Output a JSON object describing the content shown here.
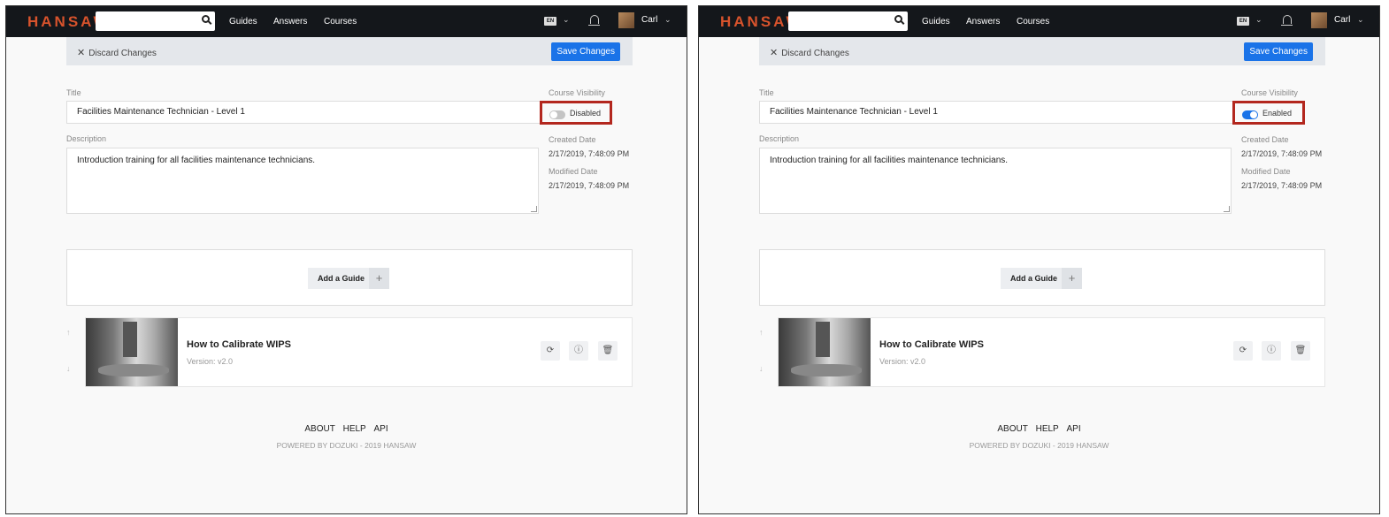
{
  "panels": [
    {
      "nav": {
        "logo": "HANSAW",
        "links": [
          "Guides",
          "Answers",
          "Courses"
        ],
        "lang": "EN",
        "user": "Carl"
      },
      "toolbar": {
        "discard_label": "Discard Changes",
        "save_label": "Save Changes"
      },
      "form": {
        "title_label": "Title",
        "title_value": "Facilities Maintenance Technician - Level 1",
        "description_label": "Description",
        "description_value": "Introduction training for all facilities maintenance technicians.",
        "visibility_label": "Course Visibility",
        "visibility_state": "Disabled",
        "created_label": "Created Date",
        "created_value": "2/17/2019, 7:48:09 PM",
        "modified_label": "Modified Date",
        "modified_value": "2/17/2019, 7:48:09 PM"
      },
      "add_guide_label": "Add a Guide",
      "guide": {
        "title": "How to Calibrate WIPS",
        "version": "Version: v2.0"
      },
      "footer": {
        "links": [
          "ABOUT",
          "HELP",
          "API"
        ],
        "credit": "POWERED BY DOZUKI - 2019 HANSAW"
      }
    },
    {
      "nav": {
        "logo": "HANSAW",
        "links": [
          "Guides",
          "Answers",
          "Courses"
        ],
        "lang": "EN",
        "user": "Carl"
      },
      "toolbar": {
        "discard_label": "Discard Changes",
        "save_label": "Save Changes"
      },
      "form": {
        "title_label": "Title",
        "title_value": "Facilities Maintenance Technician - Level 1",
        "description_label": "Description",
        "description_value": "Introduction training for all facilities maintenance technicians.",
        "visibility_label": "Course Visibility",
        "visibility_state": "Enabled",
        "created_label": "Created Date",
        "created_value": "2/17/2019, 7:48:09 PM",
        "modified_label": "Modified Date",
        "modified_value": "2/17/2019, 7:48:09 PM"
      },
      "add_guide_label": "Add a Guide",
      "guide": {
        "title": "How to Calibrate WIPS",
        "version": "Version: v2.0"
      },
      "footer": {
        "links": [
          "ABOUT",
          "HELP",
          "API"
        ],
        "credit": "POWERED BY DOZUKI - 2019 HANSAW"
      }
    }
  ],
  "colors": {
    "nav_bg": "#14171b",
    "logo": "#d8532c",
    "accent": "#1a73e8",
    "highlight_box": "#b3271e"
  }
}
